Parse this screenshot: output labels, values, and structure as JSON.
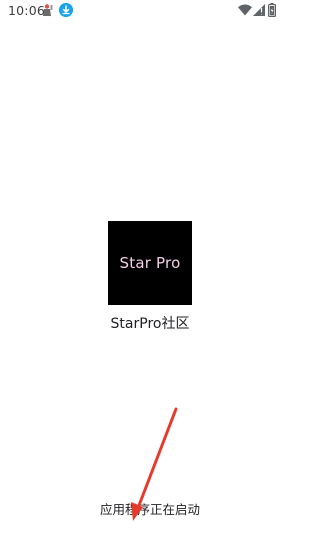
{
  "status_bar": {
    "time": "10:06",
    "icons": [
      "notification-app-icon",
      "download-icon",
      "wifi-icon",
      "cellular-signal-icon",
      "battery-icon"
    ]
  },
  "splash": {
    "logo_text": "Star Pro",
    "app_name": "StarPro社区",
    "loading_message": "应用程序正在启动"
  },
  "colors": {
    "background": "#ffffff",
    "logo_background": "#000000",
    "logo_text": "#f4cfe6",
    "download_badge": "#1aa3f0",
    "annotation_arrow": "#e53b2c"
  }
}
